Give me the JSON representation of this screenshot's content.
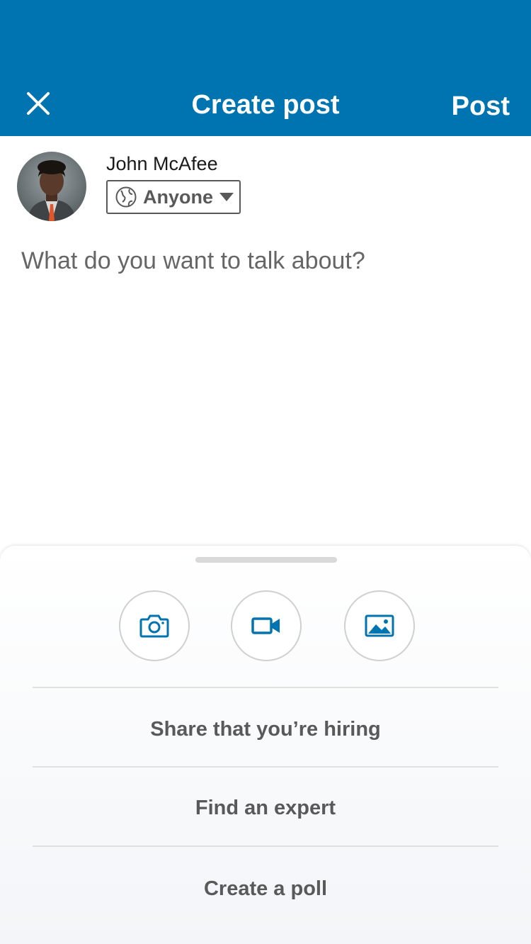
{
  "header": {
    "close_icon": "close-icon",
    "title": "Create post",
    "post_label": "Post",
    "color": "#0073b1"
  },
  "author": {
    "name": "John McAfee",
    "avatar": "avatar-photo",
    "visibility": {
      "label": "Anyone",
      "icon": "globe-icon",
      "caret_icon": "caret-down-icon"
    }
  },
  "composer": {
    "placeholder": "What do you want to talk about?"
  },
  "sheet": {
    "media_buttons": [
      {
        "name": "camera-icon"
      },
      {
        "name": "video-icon"
      },
      {
        "name": "image-icon"
      }
    ],
    "options": [
      {
        "label": "Share that you’re hiring"
      },
      {
        "label": "Find an expert"
      },
      {
        "label": "Create a poll"
      }
    ],
    "accent": "#0073b1"
  }
}
